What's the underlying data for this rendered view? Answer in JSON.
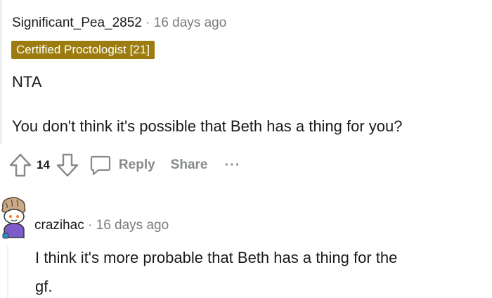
{
  "comment": {
    "username": "Significant_Pea_2852",
    "separator": "·",
    "time": "16 days ago",
    "flair": "Certified Proctologist [21]",
    "body_line1": "NTA",
    "body_line2": "You don't think it's possible that Beth has a thing for you?",
    "score": "14",
    "reply_label": "Reply",
    "share_label": "Share",
    "more_label": "···"
  },
  "reply": {
    "username": "crazihac",
    "separator": "·",
    "time": "16 days ago",
    "body_line1": "I think it's more probable that Beth has a thing for the",
    "body_line2": "gf."
  },
  "colors": {
    "flair_bg": "#9c7c0e",
    "muted": "#787c7e",
    "action": "#878a8c",
    "text": "#1a1a1b"
  }
}
